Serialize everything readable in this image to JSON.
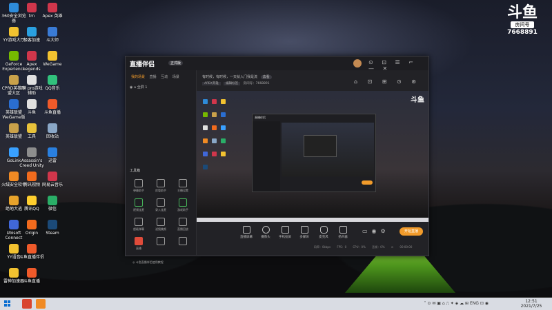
{
  "desktop_icons": [
    {
      "label": "360安全浏览器",
      "color": "#2e8bd9"
    },
    {
      "label": "YY游戏大厅",
      "color": "#f2c230"
    },
    {
      "label": "GeForce Experience",
      "color": "#76b900"
    },
    {
      "label": "CPRD英雄联盟大区",
      "color": "#c9a14a"
    },
    {
      "label": "英雄联盟 WeGame版",
      "color": "#2a6ed1"
    },
    {
      "label": "英雄联盟",
      "color": "#c9a14a"
    },
    {
      "label": "GoLink",
      "color": "#39a0ff"
    },
    {
      "label": "火绒安全软件",
      "color": "#f08a24"
    },
    {
      "label": "绝地大逃",
      "color": "#e8a32b"
    },
    {
      "label": "Ubisoft Connect",
      "color": "#4067d8"
    },
    {
      "label": "YY语音",
      "color": "#f2c230"
    },
    {
      "label": "雷神加速器",
      "color": "#f2c230"
    },
    {
      "label": "trn",
      "color": "#d0364b"
    },
    {
      "label": "极客加速",
      "color": "#2aa0e0"
    },
    {
      "label": "Apex Legends",
      "color": "#d0364b"
    },
    {
      "label": "i神 pro游戏辅助",
      "color": "#e0e0e0"
    },
    {
      "label": "斗鱼",
      "color": "#e0e0e0"
    },
    {
      "label": "工具",
      "color": "#e8c23a"
    },
    {
      "label": "Assassin's Creed Unity",
      "color": "#8d8d8d"
    },
    {
      "label": "腾讯视频",
      "color": "#f26b1d"
    },
    {
      "label": "腾讯QQ",
      "color": "#ffcf2e"
    },
    {
      "label": "Origin",
      "color": "#f26b1d"
    },
    {
      "label": "斗鱼直播伴侣",
      "color": "#ef5a2a"
    },
    {
      "label": "斗鱼直播",
      "color": "#ef5a2a"
    },
    {
      "label": "Apex 英雄",
      "color": "#d0364b"
    },
    {
      "label": "斗大师",
      "color": "#3a7bd5"
    },
    {
      "label": "WeGame",
      "color": "#f2c230"
    },
    {
      "label": "QQ音乐",
      "color": "#31c27c"
    },
    {
      "label": "斗鱼直播",
      "color": "#ef5a2a"
    },
    {
      "label": "回收站",
      "color": "#8aa7c7"
    },
    {
      "label": "迅雷",
      "color": "#2a80e0"
    },
    {
      "label": "网易云音乐",
      "color": "#d0364b"
    },
    {
      "label": "微信",
      "color": "#2aae67"
    },
    {
      "label": "Steam",
      "color": "#1b4a78"
    }
  ],
  "logo": {
    "glyph": "斗鱼",
    "sub": "房间号",
    "number": "7668891"
  },
  "app": {
    "brand": "直播伴侣",
    "brand_tag": "正式版",
    "title_buttons": "⊙ ⊡ ☰ ⌐ — ✕",
    "left_tabs": [
      "我的场景",
      "直播",
      "互动",
      "场景"
    ],
    "scene_label": "全屏 1",
    "tools_label": "工具箱",
    "tools": [
      {
        "label": "弹幕助手",
        "style": ""
      },
      {
        "label": "房管助手",
        "style": ""
      },
      {
        "label": "主播设置",
        "style": ""
      },
      {
        "label": "视频连麦",
        "style": "green"
      },
      {
        "label": "录入连麦",
        "style": ""
      },
      {
        "label": "游戏助手",
        "style": "green"
      },
      {
        "label": "超级弹幕",
        "style": ""
      },
      {
        "label": "滤镜美颜",
        "style": ""
      },
      {
        "label": "直播回放",
        "style": ""
      },
      {
        "label": "直播",
        "style": "red"
      },
      {
        "label": "",
        "style": ""
      },
      {
        "label": "",
        "style": ""
      }
    ],
    "left_bottom": "◎ 斗鱼直播伴侣使用教程",
    "notice": "有时候，有时候，一天就入门我是流",
    "notice_pill": "去看",
    "subbar": [
      "APEX英雄",
      "编辑标签",
      "房间号：7668891"
    ],
    "right_icons": "⌂ ⊡ ⊞ ⊙ ⊛",
    "preview_logo": "斗鱼",
    "controls": [
      "直播屏幕",
      "摄像头",
      "手机投屏",
      "多媒体",
      "麦克风",
      "扬声器"
    ],
    "start_button": "开始直播",
    "stats": [
      "码率：0kbps",
      "FPS：0",
      "CPU：0%",
      "丢帧：0%",
      "⊙ 00:00:00"
    ]
  },
  "taskbar": {
    "tray_icons": "˄ ⊙ ✉ ▣ ⌂ ⎍ ✦ ◈ ☁ ⊞ ENG ⊡ ◉",
    "time": "12:51",
    "date": "2021/7/25"
  }
}
